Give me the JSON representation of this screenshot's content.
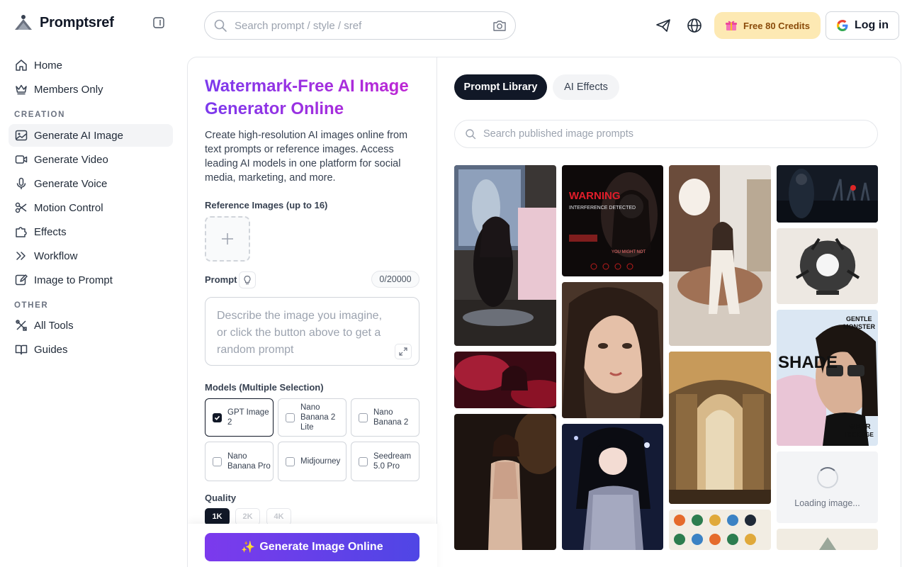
{
  "app": {
    "name": "Promptsref"
  },
  "header": {
    "search_placeholder": "Search prompt / style / sref",
    "credits_label": "Free 80 Credits",
    "login_label": "Log in"
  },
  "sidebar": {
    "top_items": [
      {
        "label": "Home",
        "icon": "home-icon"
      },
      {
        "label": "Members Only",
        "icon": "crown-icon"
      }
    ],
    "creation_heading": "CREATION",
    "creation_items": [
      {
        "label": "Generate AI Image",
        "icon": "image-icon",
        "active": true
      },
      {
        "label": "Generate Video",
        "icon": "video-icon"
      },
      {
        "label": "Generate Voice",
        "icon": "microphone-icon"
      },
      {
        "label": "Motion Control",
        "icon": "scissors-icon"
      },
      {
        "label": "Effects",
        "icon": "puzzle-icon"
      },
      {
        "label": "Workflow",
        "icon": "workflow-icon"
      },
      {
        "label": "Image to Prompt",
        "icon": "edit-icon"
      }
    ],
    "other_heading": "OTHER",
    "other_items": [
      {
        "label": "All Tools",
        "icon": "tools-icon"
      },
      {
        "label": "Guides",
        "icon": "book-icon"
      }
    ]
  },
  "generator": {
    "title": "Watermark-Free AI Image Generator Online",
    "description": "Create high-resolution AI images online from text prompts or reference images. Access leading AI models in one platform for social media, marketing, and more.",
    "reference_label": "Reference Images (up to 16)",
    "prompt_label": "Prompt",
    "prompt_counter": "0/20000",
    "prompt_placeholder": "Describe the image you imagine, or click the button above to get a random prompt",
    "models_label": "Models (Multiple Selection)",
    "models": [
      {
        "label": "GPT Image 2",
        "selected": true
      },
      {
        "label": "Nano Banana 2 Lite",
        "selected": false
      },
      {
        "label": "Nano Banana 2",
        "selected": false
      },
      {
        "label": "Nano Banana Pro",
        "selected": false
      },
      {
        "label": "Midjourney",
        "selected": false
      },
      {
        "label": "Seedream 5.0 Pro",
        "selected": false
      }
    ],
    "quality_label": "Quality",
    "quality_options": [
      {
        "label": "1K",
        "selected": true
      },
      {
        "label": "2K",
        "selected": false
      },
      {
        "label": "4K",
        "selected": false
      }
    ],
    "generate_label": "Generate Image Online",
    "generate_emoji": "✨"
  },
  "library": {
    "tabs": [
      {
        "label": "Prompt Library",
        "active": true
      },
      {
        "label": "AI Effects",
        "active": false
      }
    ],
    "search_placeholder": "Search published image prompts",
    "loading_text": "Loading image...",
    "thumbnail_text": {
      "warning_title": "WARNING",
      "warning_line": "INTERFERENCE DETECTED",
      "warning_footer": "YOU MIGHT NOT",
      "gentle": "GENTLE",
      "monster": "MONSTER",
      "shade": "SHADE",
      "wear": "WEAR",
      "the_edge": "THE EDGE"
    }
  }
}
